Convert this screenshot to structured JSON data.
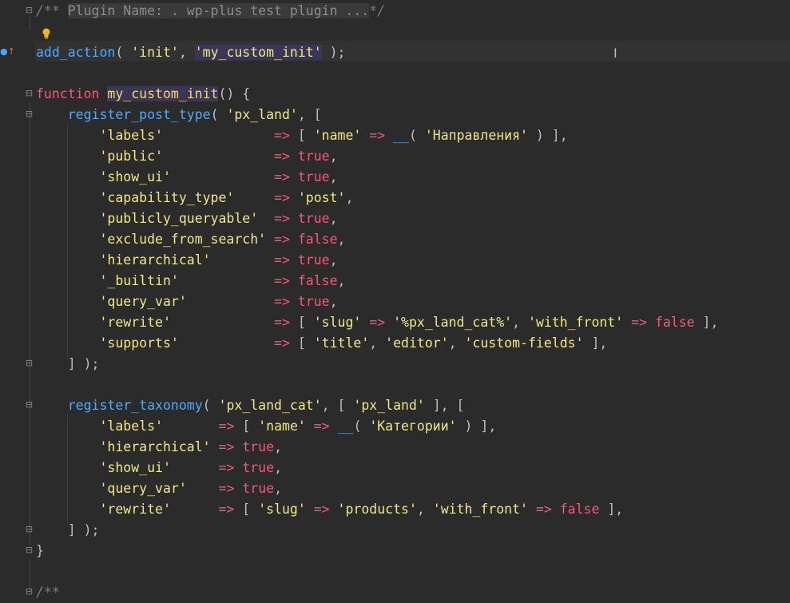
{
  "editor": {
    "lines": [
      [
        {
          "t": "/** ",
          "c": "cmt"
        },
        {
          "t": "Plugin Name: . wp-plus test plugin ...",
          "c": "cmt-fold"
        },
        {
          "t": "*/",
          "c": "cmt"
        }
      ],
      [],
      [
        {
          "t": "add_action",
          "c": "fn"
        },
        {
          "t": "( ",
          "c": "pun"
        },
        {
          "t": "'init'",
          "c": "str"
        },
        {
          "t": ", ",
          "c": "pun"
        },
        {
          "t": "'my_custom_init'",
          "c": "str-hl"
        },
        {
          "t": " );",
          "c": "pun"
        }
      ],
      [],
      [
        {
          "t": "function ",
          "c": "kw"
        },
        {
          "t": "my_custom_init",
          "c": "fn-decl"
        },
        {
          "t": "() {",
          "c": "pun"
        }
      ],
      [
        {
          "t": "    ",
          "c": "pun"
        },
        {
          "t": "register_post_type",
          "c": "fn"
        },
        {
          "t": "( ",
          "c": "pun"
        },
        {
          "t": "'px_land'",
          "c": "str"
        },
        {
          "t": ", [",
          "c": "pun"
        }
      ],
      [
        {
          "t": "        ",
          "c": "pun"
        },
        {
          "t": "'labels'",
          "c": "str"
        },
        {
          "t": "              ",
          "c": "pun"
        },
        {
          "t": "=>",
          "c": "op"
        },
        {
          "t": " [ ",
          "c": "pun"
        },
        {
          "t": "'name'",
          "c": "str"
        },
        {
          "t": " ",
          "c": "pun"
        },
        {
          "t": "=>",
          "c": "op"
        },
        {
          "t": " ",
          "c": "pun"
        },
        {
          "t": "__",
          "c": "fn"
        },
        {
          "t": "( ",
          "c": "pun"
        },
        {
          "t": "'Направления'",
          "c": "str"
        },
        {
          "t": " ) ],",
          "c": "pun"
        }
      ],
      [
        {
          "t": "        ",
          "c": "pun"
        },
        {
          "t": "'public'",
          "c": "str"
        },
        {
          "t": "              ",
          "c": "pun"
        },
        {
          "t": "=>",
          "c": "op"
        },
        {
          "t": " ",
          "c": "pun"
        },
        {
          "t": "true",
          "c": "kw"
        },
        {
          "t": ",",
          "c": "pun"
        }
      ],
      [
        {
          "t": "        ",
          "c": "pun"
        },
        {
          "t": "'show_ui'",
          "c": "str"
        },
        {
          "t": "             ",
          "c": "pun"
        },
        {
          "t": "=>",
          "c": "op"
        },
        {
          "t": " ",
          "c": "pun"
        },
        {
          "t": "true",
          "c": "kw"
        },
        {
          "t": ",",
          "c": "pun"
        }
      ],
      [
        {
          "t": "        ",
          "c": "pun"
        },
        {
          "t": "'capability_type'",
          "c": "str"
        },
        {
          "t": "     ",
          "c": "pun"
        },
        {
          "t": "=>",
          "c": "op"
        },
        {
          "t": " ",
          "c": "pun"
        },
        {
          "t": "'post'",
          "c": "str"
        },
        {
          "t": ",",
          "c": "pun"
        }
      ],
      [
        {
          "t": "        ",
          "c": "pun"
        },
        {
          "t": "'publicly_queryable'",
          "c": "str"
        },
        {
          "t": "  ",
          "c": "pun"
        },
        {
          "t": "=>",
          "c": "op"
        },
        {
          "t": " ",
          "c": "pun"
        },
        {
          "t": "true",
          "c": "kw"
        },
        {
          "t": ",",
          "c": "pun"
        }
      ],
      [
        {
          "t": "        ",
          "c": "pun"
        },
        {
          "t": "'exclude_from_search'",
          "c": "str"
        },
        {
          "t": " ",
          "c": "pun"
        },
        {
          "t": "=>",
          "c": "op"
        },
        {
          "t": " ",
          "c": "pun"
        },
        {
          "t": "false",
          "c": "kw"
        },
        {
          "t": ",",
          "c": "pun"
        }
      ],
      [
        {
          "t": "        ",
          "c": "pun"
        },
        {
          "t": "'hierarchical'",
          "c": "str"
        },
        {
          "t": "        ",
          "c": "pun"
        },
        {
          "t": "=>",
          "c": "op"
        },
        {
          "t": " ",
          "c": "pun"
        },
        {
          "t": "true",
          "c": "kw"
        },
        {
          "t": ",",
          "c": "pun"
        }
      ],
      [
        {
          "t": "        ",
          "c": "pun"
        },
        {
          "t": "'_builtin'",
          "c": "str"
        },
        {
          "t": "            ",
          "c": "pun"
        },
        {
          "t": "=>",
          "c": "op"
        },
        {
          "t": " ",
          "c": "pun"
        },
        {
          "t": "false",
          "c": "kw"
        },
        {
          "t": ",",
          "c": "pun"
        }
      ],
      [
        {
          "t": "        ",
          "c": "pun"
        },
        {
          "t": "'query_var'",
          "c": "str"
        },
        {
          "t": "           ",
          "c": "pun"
        },
        {
          "t": "=>",
          "c": "op"
        },
        {
          "t": " ",
          "c": "pun"
        },
        {
          "t": "true",
          "c": "kw"
        },
        {
          "t": ",",
          "c": "pun"
        }
      ],
      [
        {
          "t": "        ",
          "c": "pun"
        },
        {
          "t": "'rewrite'",
          "c": "str"
        },
        {
          "t": "             ",
          "c": "pun"
        },
        {
          "t": "=>",
          "c": "op"
        },
        {
          "t": " [ ",
          "c": "pun"
        },
        {
          "t": "'slug'",
          "c": "str"
        },
        {
          "t": " ",
          "c": "pun"
        },
        {
          "t": "=>",
          "c": "op"
        },
        {
          "t": " ",
          "c": "pun"
        },
        {
          "t": "'%px_land_cat%'",
          "c": "str"
        },
        {
          "t": ", ",
          "c": "pun"
        },
        {
          "t": "'with_front'",
          "c": "str"
        },
        {
          "t": " ",
          "c": "pun"
        },
        {
          "t": "=>",
          "c": "op"
        },
        {
          "t": " ",
          "c": "pun"
        },
        {
          "t": "false",
          "c": "kw"
        },
        {
          "t": " ],",
          "c": "pun"
        }
      ],
      [
        {
          "t": "        ",
          "c": "pun"
        },
        {
          "t": "'supports'",
          "c": "str"
        },
        {
          "t": "            ",
          "c": "pun"
        },
        {
          "t": "=>",
          "c": "op"
        },
        {
          "t": " [ ",
          "c": "pun"
        },
        {
          "t": "'title'",
          "c": "str"
        },
        {
          "t": ", ",
          "c": "pun"
        },
        {
          "t": "'editor'",
          "c": "str"
        },
        {
          "t": ", ",
          "c": "pun"
        },
        {
          "t": "'custom-fields'",
          "c": "str"
        },
        {
          "t": " ],",
          "c": "pun"
        }
      ],
      [
        {
          "t": "    ] );",
          "c": "pun"
        }
      ],
      [],
      [
        {
          "t": "    ",
          "c": "pun"
        },
        {
          "t": "register_taxonomy",
          "c": "fn"
        },
        {
          "t": "( ",
          "c": "pun"
        },
        {
          "t": "'px_land_cat'",
          "c": "str"
        },
        {
          "t": ", [ ",
          "c": "pun"
        },
        {
          "t": "'px_land'",
          "c": "str"
        },
        {
          "t": " ], [",
          "c": "pun"
        }
      ],
      [
        {
          "t": "        ",
          "c": "pun"
        },
        {
          "t": "'labels'",
          "c": "str"
        },
        {
          "t": "       ",
          "c": "pun"
        },
        {
          "t": "=>",
          "c": "op"
        },
        {
          "t": " [ ",
          "c": "pun"
        },
        {
          "t": "'name'",
          "c": "str"
        },
        {
          "t": " ",
          "c": "pun"
        },
        {
          "t": "=>",
          "c": "op"
        },
        {
          "t": " ",
          "c": "pun"
        },
        {
          "t": "__",
          "c": "fn"
        },
        {
          "t": "( ",
          "c": "pun"
        },
        {
          "t": "'Категории'",
          "c": "str"
        },
        {
          "t": " ) ],",
          "c": "pun"
        }
      ],
      [
        {
          "t": "        ",
          "c": "pun"
        },
        {
          "t": "'hierarchical'",
          "c": "str"
        },
        {
          "t": " ",
          "c": "pun"
        },
        {
          "t": "=>",
          "c": "op"
        },
        {
          "t": " ",
          "c": "pun"
        },
        {
          "t": "true",
          "c": "kw"
        },
        {
          "t": ",",
          "c": "pun"
        }
      ],
      [
        {
          "t": "        ",
          "c": "pun"
        },
        {
          "t": "'show_ui'",
          "c": "str"
        },
        {
          "t": "      ",
          "c": "pun"
        },
        {
          "t": "=>",
          "c": "op"
        },
        {
          "t": " ",
          "c": "pun"
        },
        {
          "t": "true",
          "c": "kw"
        },
        {
          "t": ",",
          "c": "pun"
        }
      ],
      [
        {
          "t": "        ",
          "c": "pun"
        },
        {
          "t": "'query_var'",
          "c": "str"
        },
        {
          "t": "    ",
          "c": "pun"
        },
        {
          "t": "=>",
          "c": "op"
        },
        {
          "t": " ",
          "c": "pun"
        },
        {
          "t": "true",
          "c": "kw"
        },
        {
          "t": ",",
          "c": "pun"
        }
      ],
      [
        {
          "t": "        ",
          "c": "pun"
        },
        {
          "t": "'rewrite'",
          "c": "str"
        },
        {
          "t": "      ",
          "c": "pun"
        },
        {
          "t": "=>",
          "c": "op"
        },
        {
          "t": " [ ",
          "c": "pun"
        },
        {
          "t": "'slug'",
          "c": "str"
        },
        {
          "t": " ",
          "c": "pun"
        },
        {
          "t": "=>",
          "c": "op"
        },
        {
          "t": " ",
          "c": "pun"
        },
        {
          "t": "'products'",
          "c": "str"
        },
        {
          "t": ", ",
          "c": "pun"
        },
        {
          "t": "'with_front'",
          "c": "str"
        },
        {
          "t": " ",
          "c": "pun"
        },
        {
          "t": "=>",
          "c": "op"
        },
        {
          "t": " ",
          "c": "pun"
        },
        {
          "t": "false",
          "c": "kw"
        },
        {
          "t": " ],",
          "c": "pun"
        }
      ],
      [
        {
          "t": "    ] );",
          "c": "pun"
        }
      ],
      [
        {
          "t": "}",
          "c": "pun"
        }
      ],
      [],
      [
        {
          "t": "/**",
          "c": "cmt"
        }
      ]
    ]
  }
}
